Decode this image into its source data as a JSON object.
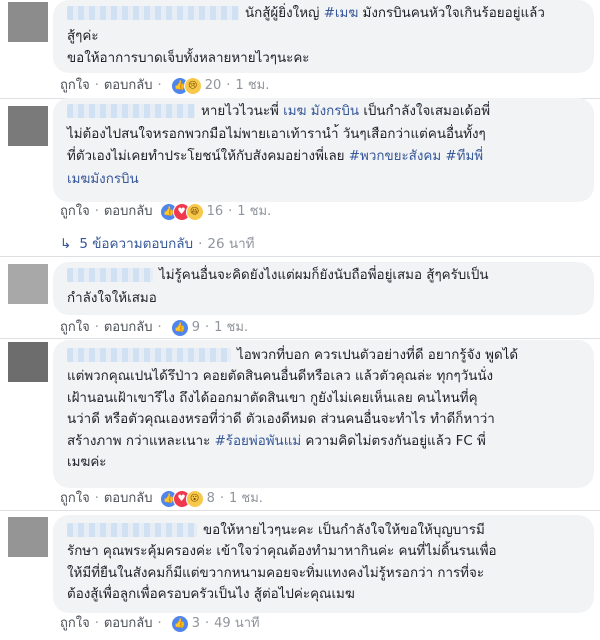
{
  "comments": [
    {
      "lines": [
        "นักสู้ผู้ยิ่งใหญ่ ",
        "#เมฆ",
        " มังกรบินคนหัวใจเกินร้อยอยู่แล้ว",
        "สู้ๆค่ะ",
        "ขอให้อาการบาดเจ็บทั้งหลายหายไวๆนะคะ"
      ],
      "like": "ถูกใจ",
      "reply": "ตอบกลับ",
      "reactions": [
        "like-icon",
        "sad-icon"
      ],
      "count": "20",
      "time": "1 ชม."
    },
    {
      "lines": [
        "หายไวไวนะพี่ ",
        "เมฆ มังกรบิน",
        " เป็นกำลังใจเสมอเด้อพี่",
        "ไม่ต้องไปสนใจหรอกพวกมือไม่พายเอาเท้ารานำ้ วันๆเสือกว่าแต่คนอื่นทั้งๆ",
        "ที่ตัวเองไม่เคยทำประโยชน์ให้กับสังคมอย่างพี่เลย ",
        "#พวกขยะสังคม",
        " ",
        "#ทีมพี่",
        "เมฆมังกรบิน"
      ],
      "like": "ถูกใจ",
      "reply": "ตอบกลับ",
      "reactions": [
        "like-icon",
        "love-icon",
        "haha-icon"
      ],
      "count": "16",
      "time": "1 ชม.",
      "replies_label": "5 ข้อความตอบกลับ",
      "replies_time": "26 นาที"
    },
    {
      "lines": [
        "ไม่รู้คนอื่นจะคิดยังไงแต่ผมก็ยังนับถือพี่อยู่เสมอ สู้ๆครับเป็น",
        "กำลังใจให้เสมอ"
      ],
      "like": "ถูกใจ",
      "reply": "ตอบกลับ",
      "reactions": [
        "like-icon"
      ],
      "count": "9",
      "time": "1 ชม."
    },
    {
      "lines": [
        "ไอพวกที่บอก ควรเปนตัวอย่างที่ดี อยากรู้จัง พูดได้",
        "แต่พวกคุณเปนได้รึป่าว คอยตัดสินคนอื่นดีหรือเลว แล้วตัวคุณล่ะ ทุกๆวันนั่ง",
        "เฝ้านอนเฝ้าเขารึไง ถึงได้ออกมาตัดสินเขา กูยังไม่เคยเห็นเลย คนไหนที่คุ",
        "นว่าดี หรือตัวคุณเองหรอที่ว่าดี ตัวเองดีหมด ส่วนคนอื่นจะทำไร ทำดีก็หาว่า",
        "สร้างภาพ กว่าแหละเนาะ ",
        "#ร้อยพ่อพันแม่",
        " ความคิดไม่ตรงกันอยู่แล้ว FC พี่",
        "เมฆค่ะ"
      ],
      "like": "ถูกใจ",
      "reply": "ตอบกลับ",
      "reactions": [
        "like-icon",
        "love-icon",
        "wow-icon"
      ],
      "count": "8",
      "time": "1 ชม."
    },
    {
      "lines": [
        "ขอให้หายไวๆนะคะ เป็นกำลังใจให้ขอให้บุญบารมี",
        "รักษา คุณพระคุ้มครองค่ะ เข้าใจว่าคุณต้องทำมาหากินค่ะ คนที่ไม่ดิ้นรนเพื่อ",
        "ให้มีที่ยืนในสังคมก็มีแต่ขวากหนามคอยจะทิ่มแทงคงไม่รู้หรอกว่า การที่จะ",
        "ต้องสู้เพื่อลูกเพื่อครอบครัวเป็นไง สู้ต่อไปค่ะคุณเมฆ"
      ],
      "like": "ถูกใจ",
      "reply": "ตอบกลับ",
      "reactions": [
        "like-icon"
      ],
      "count": "3",
      "time": "49 นาที"
    }
  ]
}
